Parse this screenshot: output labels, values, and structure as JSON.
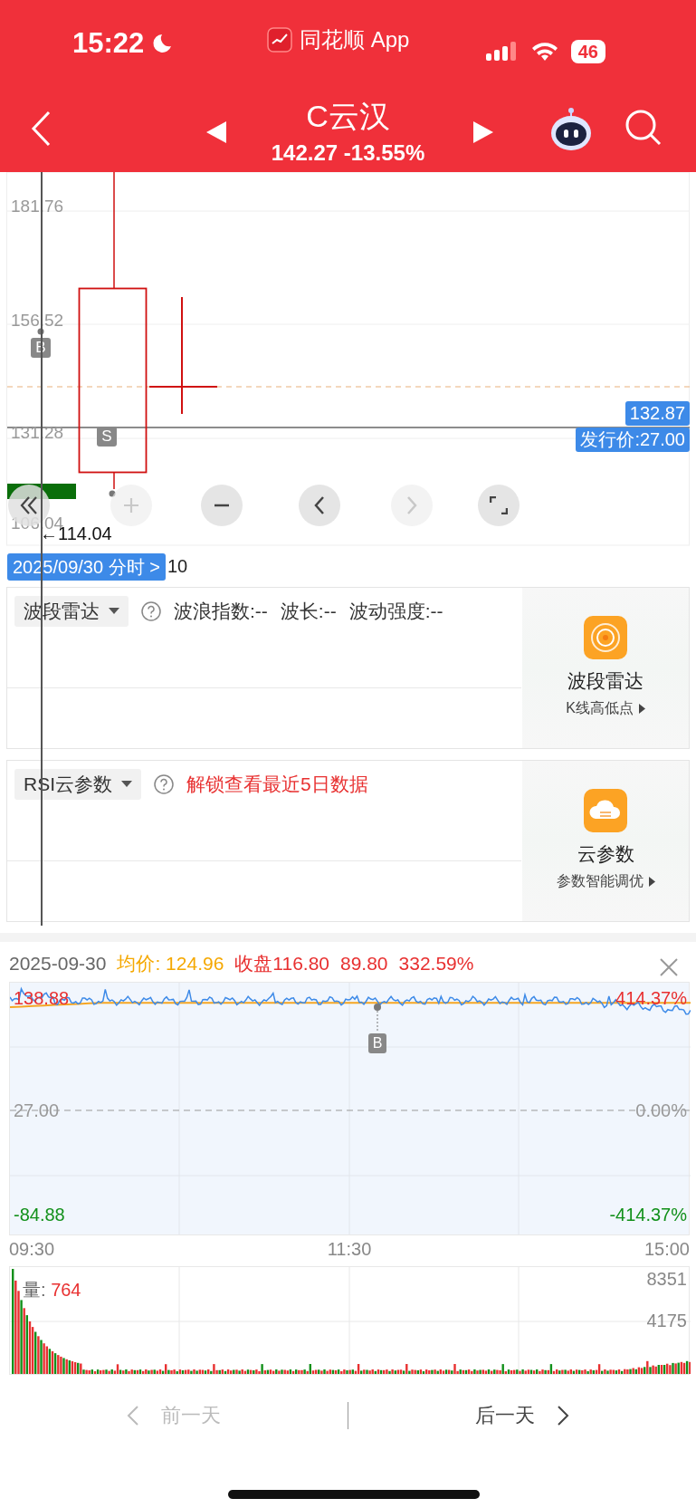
{
  "status_bar": {
    "time": "15:22",
    "app_label": "同花顺 App",
    "battery": "46"
  },
  "nav": {
    "title": "C云汉",
    "quote": "142.27 -13.55%"
  },
  "kline": {
    "y_labels": [
      "181.76",
      "156.52",
      "131.28",
      "106.04"
    ],
    "low_label": "←114.04",
    "price_tag": "132.87",
    "issue_price_tag": "发行价:27.00",
    "markers": [
      {
        "label": "B"
      },
      {
        "label": "S"
      }
    ],
    "buttons": [
      {
        "kind": "rewind",
        "disabled": false
      },
      {
        "kind": "zoom_in",
        "disabled": true
      },
      {
        "kind": "zoom_out",
        "disabled": false
      },
      {
        "kind": "prev",
        "disabled": false
      },
      {
        "kind": "next",
        "disabled": true
      },
      {
        "kind": "fullscreen",
        "disabled": false
      }
    ]
  },
  "date_tag": {
    "label": "2025/09/30 分时 >",
    "axis_label": "10"
  },
  "panels": [
    {
      "selector": "波段雷达",
      "texts": [
        {
          "kind": "metric",
          "text": "波浪指数:--"
        },
        {
          "kind": "metric",
          "text": "波长:--"
        },
        {
          "kind": "metric",
          "text": "波动强度:--"
        }
      ],
      "promo": {
        "kind": "radar",
        "title": "波段雷达",
        "subtitle": "K线高低点"
      }
    },
    {
      "selector": "RSI云参数",
      "texts": [
        {
          "kind": "notice",
          "text": "解锁查看最近5日数据"
        }
      ],
      "promo": {
        "kind": "cloud",
        "title": "云参数",
        "subtitle": "参数智能调优"
      }
    }
  ],
  "intraday": {
    "date": "2025-09-30",
    "avg": "均价: 124.96",
    "close": "收盘116.80",
    "change": "89.80",
    "pct": "332.59%",
    "left_labels": [
      "138.88",
      "27.00",
      "-84.88"
    ],
    "right_labels": [
      "414.37%",
      "0.00%",
      "-414.37%"
    ],
    "marker": "B",
    "times": [
      "09:30",
      "11:30",
      "15:00"
    ],
    "volume_label": "量:",
    "volume_value": "764",
    "volume_ticks": [
      "8351",
      "4175"
    ]
  },
  "footer": {
    "prev": {
      "label": "前一天",
      "disabled": true
    },
    "next": {
      "label": "后一天",
      "disabled": false
    }
  }
}
